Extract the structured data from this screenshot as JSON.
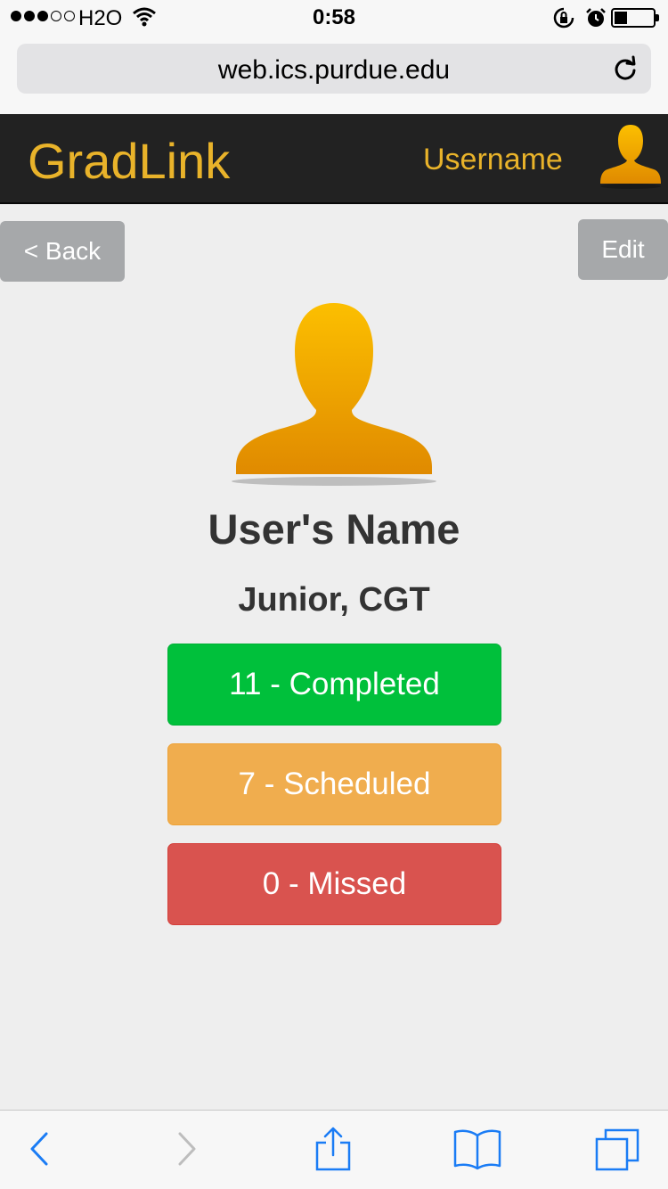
{
  "status_bar": {
    "carrier": "H2O",
    "time": "0:58",
    "signal_bars_filled": 3,
    "signal_bars_total": 5,
    "battery_level": 0.25
  },
  "browser": {
    "url": "web.ics.purdue.edu"
  },
  "navbar": {
    "brand": "GradLink",
    "username": "Username",
    "accent_color": "#e9b32a",
    "background_color": "#222222"
  },
  "actions": {
    "back_label": "< Back",
    "edit_label": "Edit"
  },
  "profile": {
    "name": "User's Name",
    "class_info": "Junior, CGT"
  },
  "stats": [
    {
      "label": "11 - Completed",
      "color": "#00c03b"
    },
    {
      "label": "7 - Scheduled",
      "color": "#f0ad4e"
    },
    {
      "label": "0 - Missed",
      "color": "#d9534f"
    }
  ],
  "toolbar": {
    "icons": [
      "back-arrow-icon",
      "forward-arrow-icon",
      "share-icon",
      "bookmarks-icon",
      "tabs-icon"
    ]
  }
}
